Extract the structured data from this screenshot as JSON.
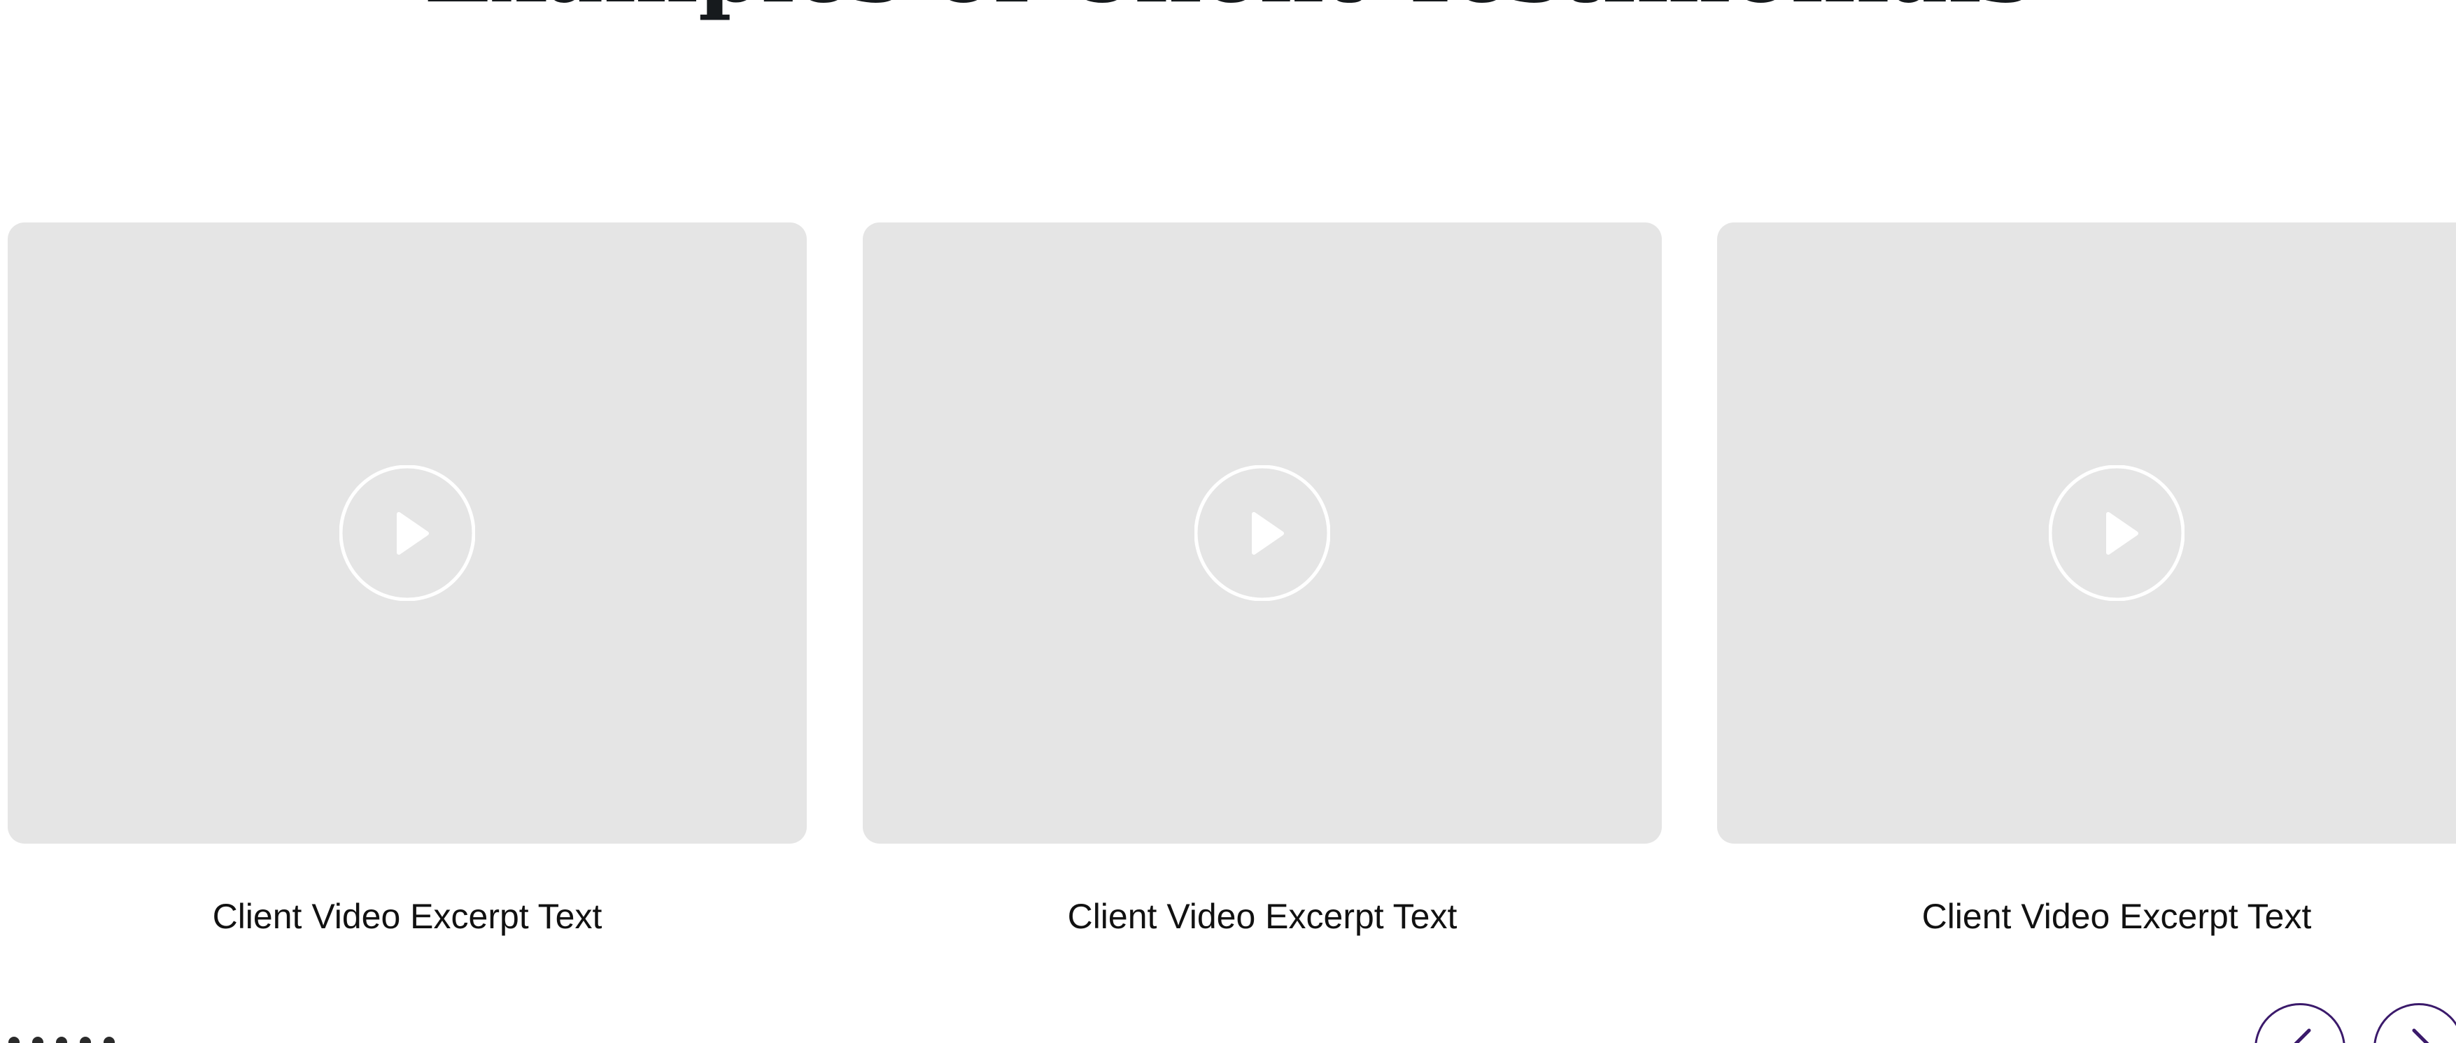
{
  "section": {
    "title": "Examples of Client Testimonials"
  },
  "testimonials": [
    {
      "caption": "Client Video Excerpt Text",
      "icon": "play-icon"
    },
    {
      "caption": "Client Video Excerpt Text",
      "icon": "play-icon"
    },
    {
      "caption": "Client Video Excerpt Text",
      "icon": "play-icon"
    }
  ],
  "carousel": {
    "prev_icon": "chevron-left-icon",
    "next_icon": "chevron-right-icon"
  },
  "colors": {
    "thumbnail_bg": "#e5e5e5",
    "title_text": "#161a1d",
    "caption_text": "#111111",
    "nav_border": "#3b1a6b",
    "play_icon": "#ffffff"
  }
}
